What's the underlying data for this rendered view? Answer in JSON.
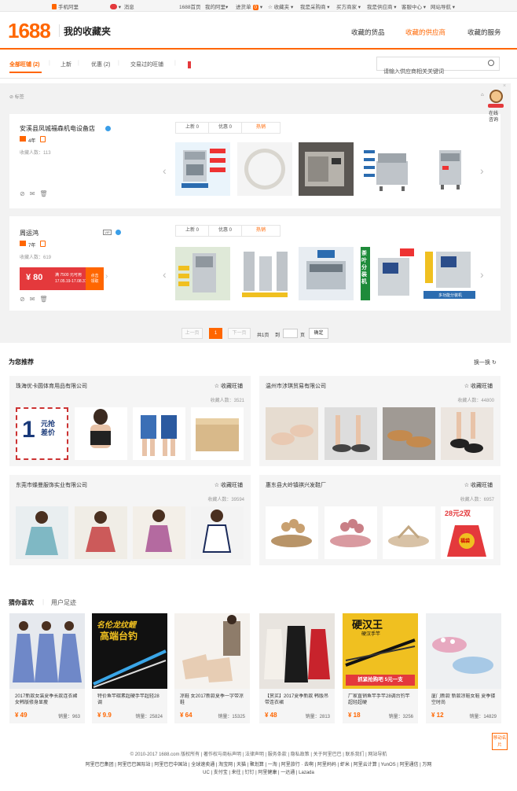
{
  "topbar": {
    "mobile": "手机阿里",
    "message": "消息",
    "links": [
      "1688首页",
      "我的阿里▾",
      "进货单",
      "☆ 收藏夹 ▾",
      "我是采购商 ▾",
      "买方商家 ▾",
      "我是供应商 ▾",
      "客服中心 ▾",
      "网站导航 ▾"
    ],
    "cart_count": "0"
  },
  "header": {
    "logo": "1688",
    "title": "我的收藏夹",
    "nav": [
      "收藏的货品",
      "收藏的供应商",
      "收藏的服务"
    ],
    "active_nav": "收藏的供应商"
  },
  "tabs": {
    "items": [
      "全部旺铺 (2)",
      "上新",
      "优惠 (2)",
      "交易过的旺铺"
    ],
    "search_placeholder": "请输入供应商相关关键词"
  },
  "tag_label": "标签",
  "side": {
    "online": "在线",
    "service": "咨询"
  },
  "suppliers": [
    {
      "name": "安溪县凤城福森机电设备店",
      "years": "4年",
      "fans": "收藏人数：113",
      "tabs": [
        "上新 0",
        "优惠 0",
        "热销"
      ]
    },
    {
      "name": "周运鸿",
      "years": "7年",
      "fans": "收藏人数：619",
      "tabs": [
        "上新 0",
        "优惠 0",
        "热销"
      ],
      "coupon": {
        "amount": "¥ 80",
        "line1": "满 7500 元可用",
        "line2": "17.05.19-17.08.31",
        "btn1": "点击",
        "btn2": "领取"
      },
      "product_texts": [
        "多功能分装机",
        "茶叶分装机"
      ]
    }
  ],
  "pager": {
    "prev": "上一页",
    "current": "1",
    "next": "下一页",
    "total": "共1页",
    "to": "到",
    "page": "页",
    "ok": "确定"
  },
  "recommend": {
    "title": "为您推荐",
    "refresh": "换一换",
    "fav_label": "☆ 收藏旺铺",
    "shops": [
      {
        "name": "珠海优卡圆体育用品有限公司",
        "fans": "收藏人数：3521"
      },
      {
        "name": "温州市涉琪贸易有限公司",
        "fans": "收藏人数：44800"
      },
      {
        "name": "东莞市蝶曼服饰实业有限公司",
        "fans": "收藏人数：39594"
      },
      {
        "name": "惠东县大岭镇祺兴发鞋厂",
        "fans": "收藏人数：6957"
      }
    ],
    "promo_texts": {
      "yuan": "元抢",
      "price": "差价",
      "one": "1",
      "promo2": "28元2双",
      "lucky": "福袋"
    }
  },
  "guess": {
    "tabs": [
      "猜你喜欢",
      "用户足迹"
    ],
    "items": [
      {
        "title": "2017新款女装夏季长款连衣裙女韩版修身显瘦",
        "price": "¥ 49",
        "sales": "销量：963"
      },
      {
        "title": "特价鱼竿碳素超硬手竿超轻28调",
        "price": "¥ 9.9",
        "sales": "销量：25824"
      },
      {
        "title": "凉鞋 女2017新款夏季一字带凉鞋",
        "price": "¥ 64",
        "sales": "销量：15325"
      },
      {
        "title": "【赏买】2017夏季新款 韩版吊带连衣裙",
        "price": "¥ 48",
        "sales": "销量：2813"
      },
      {
        "title": "厂家直销鱼竿手竿28调台钓竿超轻超硬",
        "price": "¥ 18",
        "sales": "销量：3256"
      },
      {
        "title": "厦门新款 新款凉鞋女鞋 夏季镂空时尚",
        "price": "¥ 12",
        "sales": "销量：14829"
      }
    ],
    "promo_texts": {
      "brand1": "名伦龙纹鲤",
      "brand1b": "高端台钓",
      "brand2": "硬汉王",
      "brand2b": "硬汉手竿",
      "brand2c": "抓紧抢购吧 5元一支"
    }
  },
  "footer": {
    "line1": "© 2010-2017 1688.com 版权所有 | 著作权与商标声明 | 法律声明 | 服务条款 | 隐私政策 | 关于阿里巴巴 | 联系我们 | 网站导航",
    "line2": "阿里巴巴集团 | 阿里巴巴国际站 | 阿里巴巴中国站 | 全球速卖通 | 淘宝网 | 天猫 | 聚划算 | 一淘 | 阿里旅行 · 去啊 | 阿里妈妈 | 虾米 | 阿里云计算 | YunOS | 阿里通信 | 万网",
    "line3": "UC | 支付宝 | 来往 | 钉钉 | 阿里健康 | 一达通 | Lazada",
    "side_btn": "移动名片"
  },
  "colors": {
    "accent": "#ff6600",
    "red": "#e4393c",
    "gray_bg": "#f2f2f2"
  }
}
